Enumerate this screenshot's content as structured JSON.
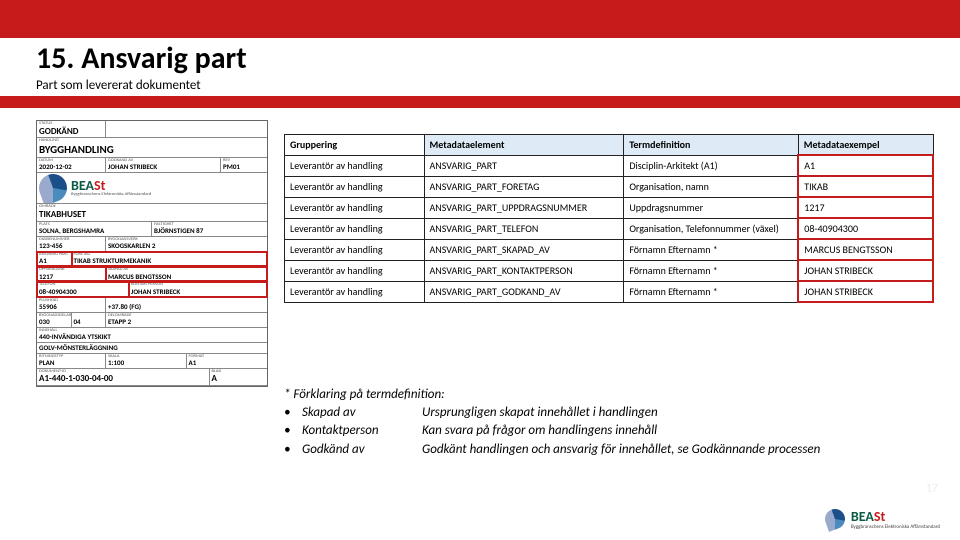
{
  "header": {
    "title": "15. Ansvarig part",
    "subtitle": "Part som levererat dokumentet"
  },
  "form": {
    "status_label": "STATUS",
    "status": "GODKÄND",
    "handling_label": "HANDLING",
    "handling": "BYGGHANDLING",
    "datum_label": "DATUM",
    "datum": "2020-12-02",
    "godkand_av_label": "GODKÄND AV",
    "godkand_av": "JOHAN STRIBECK",
    "rev_label": "REV",
    "rev": "PM01",
    "brand": "BEASt",
    "brand_sub": "Byggbranschens Elektroniska Affärsstandard",
    "omrade_label": "OMRÅDE",
    "omrade": "TIKABHUSET",
    "plats_label": "PLATS",
    "plats": "SOLNA, BERGSHAMRA",
    "fastighet_label": "FASTIGHET",
    "fastighet": "BJÖRNSTIGEN 87",
    "diarie_label": "DIARIENUMMER",
    "diarie": "123-456",
    "byggnad_label": "BYGGNADSVERK",
    "byggnad": "SKOGSKARLEN 2",
    "ansv_part_label": "ANSVARIG PART",
    "ansv_part": "A1",
    "foretag_label": "FÖRETAG",
    "foretag": "TIKAB STRUKTURMEKANIK",
    "uppdrag_label": "UPPDRAGSNR",
    "uppdrag": "1217",
    "skapad_av_label": "SKAPAD AV",
    "skapad_av": "MARCUS BENGTSSON",
    "tel_label": "TELEFON",
    "tel": "08-40904300",
    "kontakt_label": "KONTAKTPERSON",
    "kontakt": "JOHAN STRIBECK",
    "plushojd_label": "PLUSHÖJD",
    "plushojd_a": "55906",
    "plushojd_b": "+37.80 (FG)",
    "byggdelar_label": "BYGGNADSDELAR",
    "bd_a": "030",
    "bd_b": "04",
    "delomr_label": "DELOMRÅDE",
    "delomr": "ETAPP 2",
    "innehall_label": "INNEHÅLL",
    "innehall1": "440-INVÄNDIGA YTSKIKT",
    "innehall2": "GOLV-MÖNSTERLÄGGNING",
    "rit1_label": "RITNINGSTYP",
    "rit1": "PLAN",
    "skala_label": "SKALA",
    "skala": "1:100",
    "format_label": "FORMAT",
    "format": "A1",
    "docid_label": "DOKUMENT-ID",
    "docid": "A1-440-1-030-04-00",
    "blad_label": "BLAD",
    "blad": "A"
  },
  "table": {
    "head": {
      "c1": "Gruppering",
      "c2": "Metadataelement",
      "c3": "Termdefinition",
      "c4": "Metadataexempel"
    },
    "r1": {
      "c1": "Leverantör av handling",
      "c2": "ANSVARIG_PART",
      "c3": "Disciplin-Arkitekt (A1)",
      "c4": "A1"
    },
    "r2": {
      "c1": "Leverantör av handling",
      "c2": "ANSVARIG_PART_FORETAG",
      "c3": "Organisation, namn",
      "c4": "TIKAB"
    },
    "r3": {
      "c1": "Leverantör av handling",
      "c2": "ANSVARIG_PART_UPPDRAGSNUMMER",
      "c3": "Uppdragsnummer",
      "c4": "1217"
    },
    "r4": {
      "c1": "Leverantör av handling",
      "c2": "ANSVARIG_PART_TELEFON",
      "c3": "Organisation, Telefonnummer (växel)",
      "c4": "08-40904300"
    },
    "r5": {
      "c1": "Leverantör av handling",
      "c2": "ANSVARIG_PART_SKAPAD_AV",
      "c3": "Förnamn Efternamn *",
      "c4": "MARCUS BENGTSSON"
    },
    "r6": {
      "c1": "Leverantör av handling",
      "c2": "ANSVARIG_PART_KONTAKTPERSON",
      "c3": "Förnamn Efternamn *",
      "c4": "JOHAN STRIBECK"
    },
    "r7": {
      "c1": "Leverantör av handling",
      "c2": "ANSVARIG_PART_GODKAND_AV",
      "c3": "Förnamn Efternamn *",
      "c4": "JOHAN STRIBECK"
    }
  },
  "explain": {
    "lead": "* Förklaring på termdefinition:",
    "bullet": "•",
    "r1_term": "Skapad av",
    "r1_def": "Ursprungligen skapat innehållet i handlingen",
    "r2_term": "Kontaktperson",
    "r2_def": "Kan svara på frågor om handlingens innehåll",
    "r3_term": "Godkänd av",
    "r3_def": "Godkänt handlingen och ansvarig för innehållet, se Godkännande processen"
  },
  "footer": {
    "brand_a": "BEA",
    "brand_b": "St",
    "tagline": "Byggbranschens Elektroniska Affärsstandard"
  },
  "pagenum": "17"
}
